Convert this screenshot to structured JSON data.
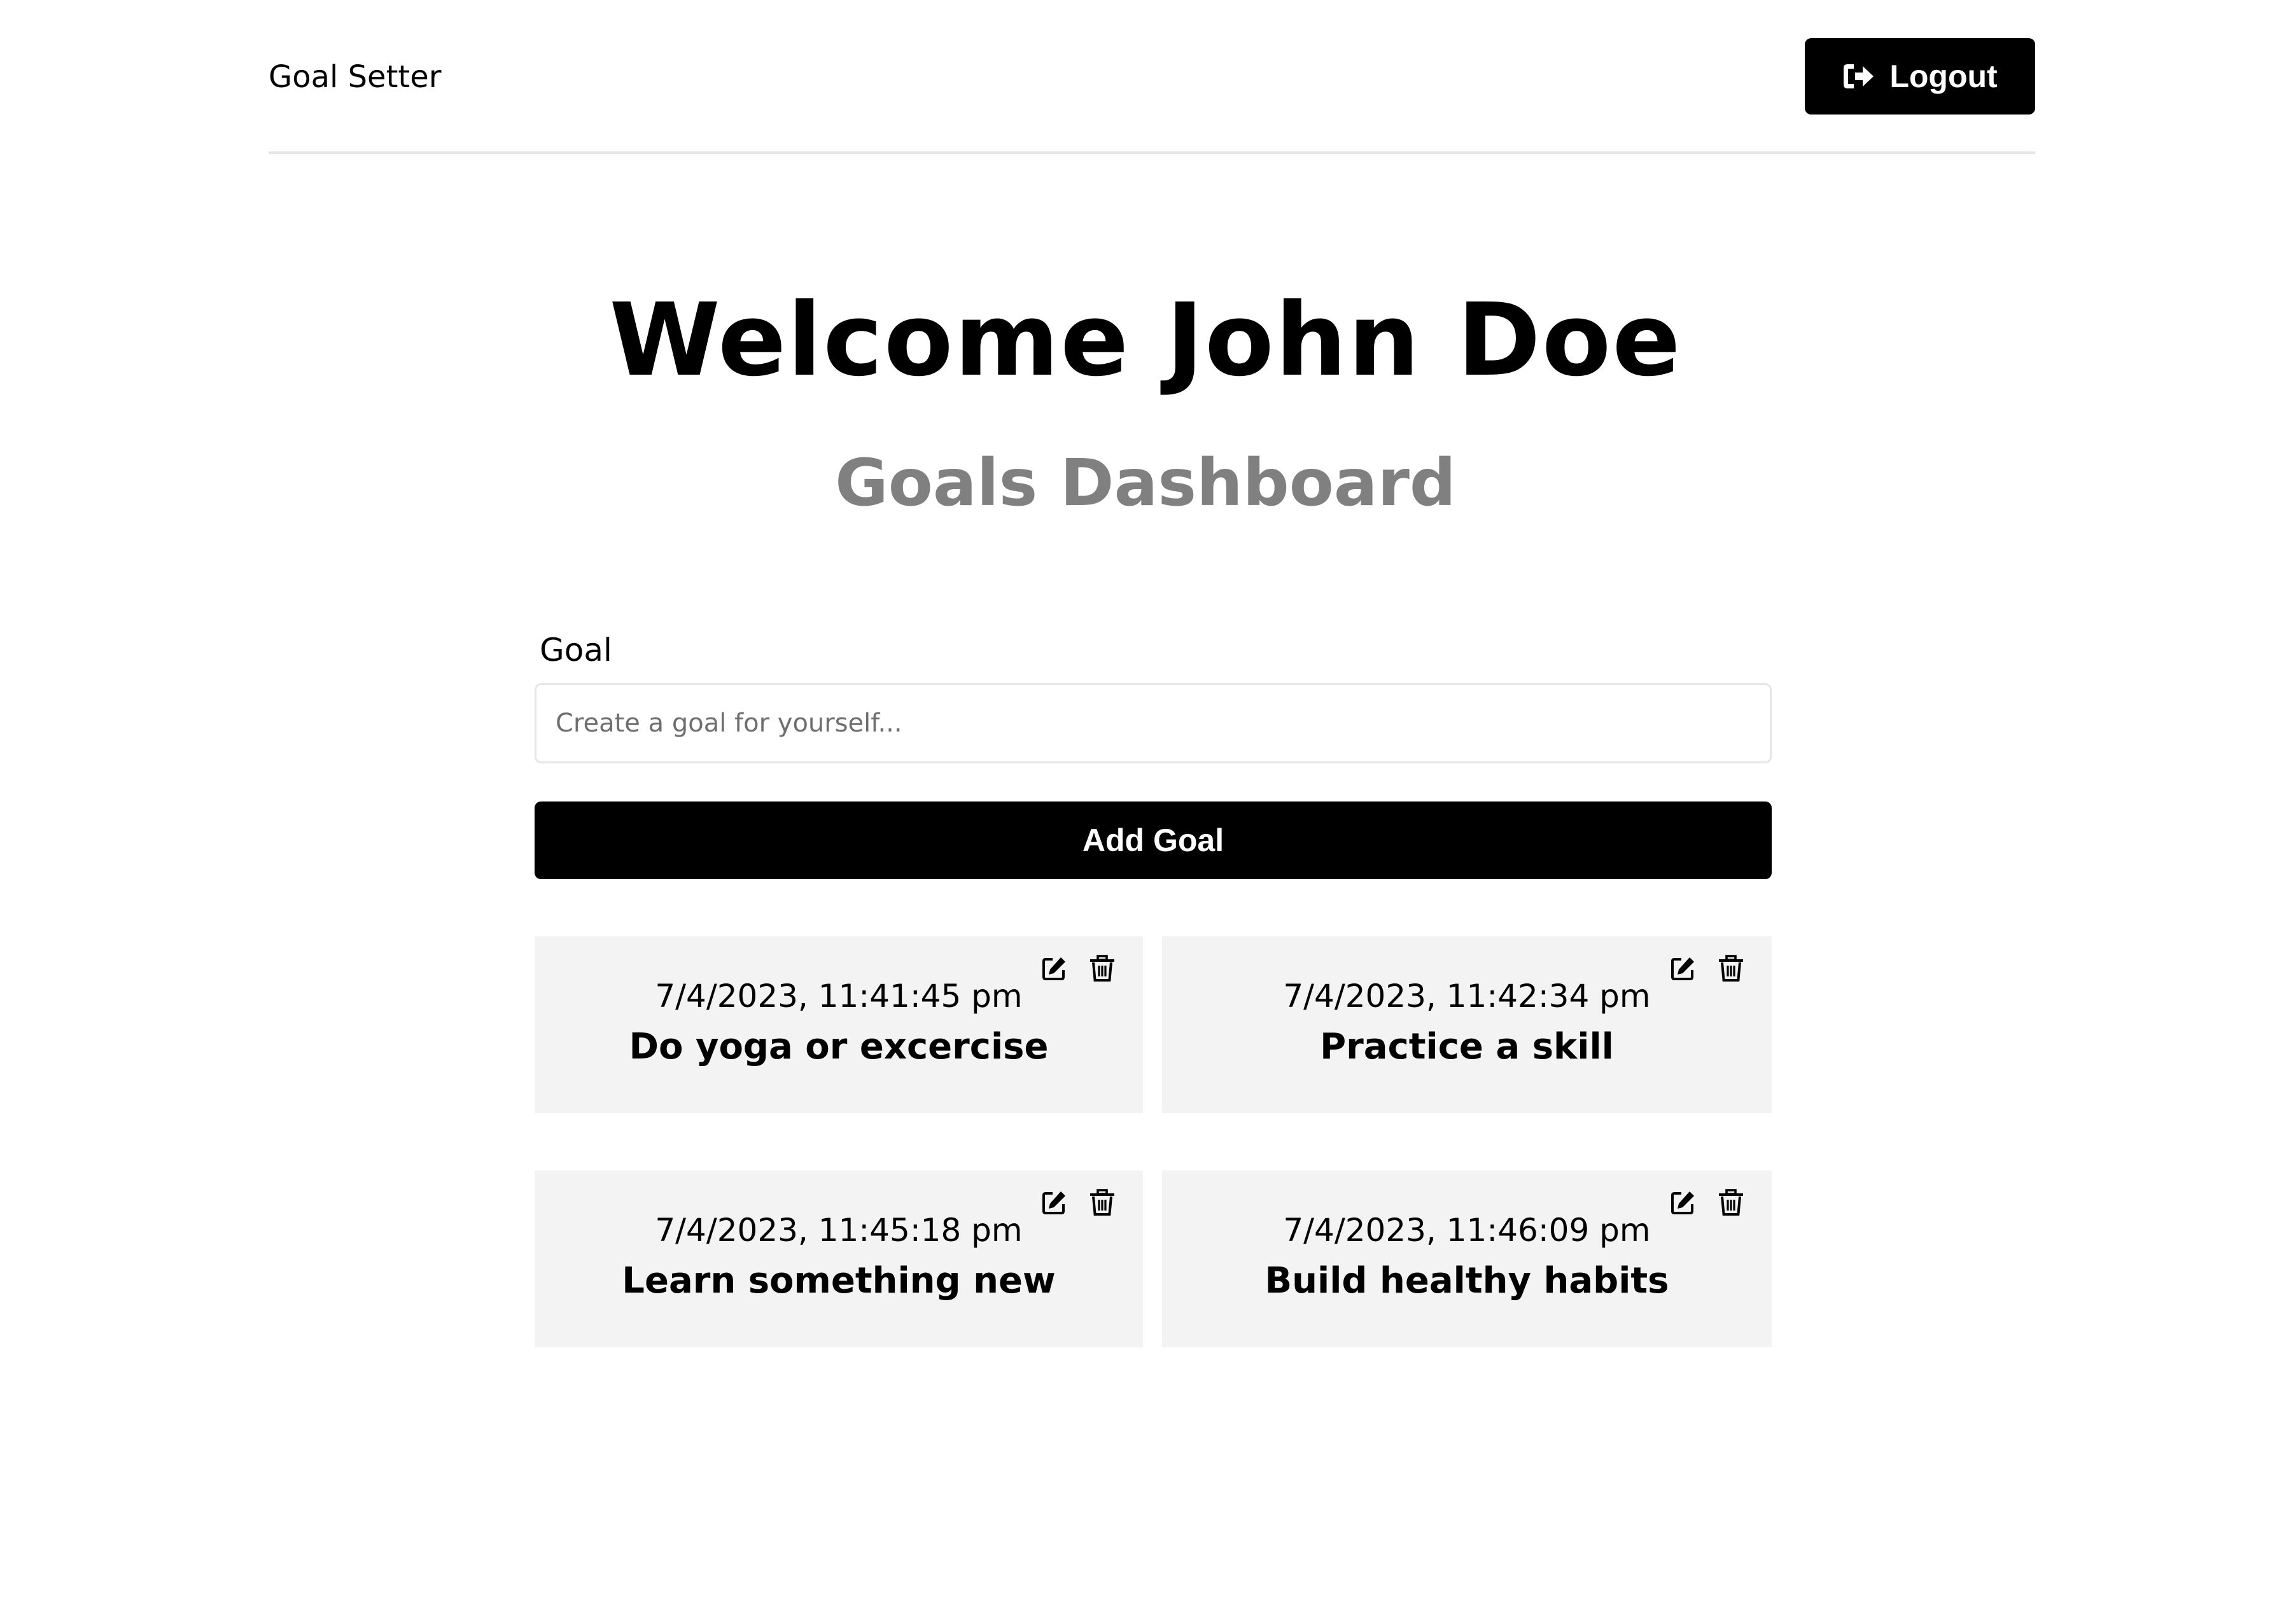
{
  "header": {
    "brand": "Goal Setter",
    "logout_label": "Logout"
  },
  "main": {
    "welcome": "Welcome John Doe",
    "subtitle": "Goals Dashboard"
  },
  "form": {
    "label": "Goal",
    "placeholder": "Create a goal for yourself...",
    "value": "",
    "submit_label": "Add Goal"
  },
  "goals": [
    {
      "date": "7/4/2023, 11:41:45 pm",
      "text": "Do yoga or excercise"
    },
    {
      "date": "7/4/2023, 11:42:34 pm",
      "text": "Practice a skill"
    },
    {
      "date": "7/4/2023, 11:45:18 pm",
      "text": "Learn something new"
    },
    {
      "date": "7/4/2023, 11:46:09 pm",
      "text": "Build healthy habits"
    }
  ],
  "icons": {
    "logout": "sign-out-icon",
    "edit": "edit-icon",
    "delete": "trash-icon"
  },
  "colors": {
    "primary": "#000000",
    "subtitle": "#808080",
    "card_bg": "#f3f3f3",
    "border": "#e6e6e6"
  }
}
